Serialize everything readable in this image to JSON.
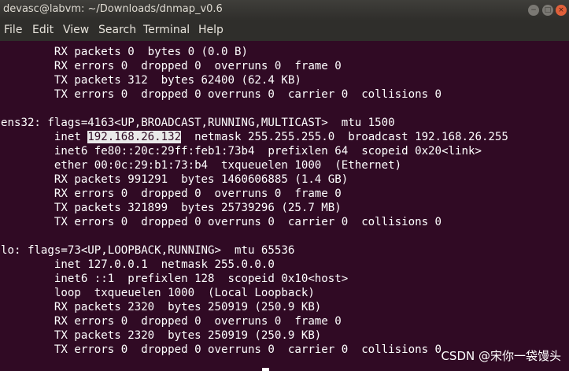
{
  "window": {
    "title": "devasc@labvm: ~/Downloads/dnmap_v0.6",
    "buttons": {
      "minimize": "−",
      "maximize": "□",
      "close": "×"
    }
  },
  "menu": [
    "File",
    "Edit",
    "View",
    "Search",
    "Terminal",
    "Help"
  ],
  "terminal": {
    "lines": [
      {
        "segments": [
          {
            "text": "        RX packets 0  bytes 0 (0.0 B)"
          }
        ]
      },
      {
        "segments": [
          {
            "text": "        RX errors 0  dropped 0  overruns 0  frame 0"
          }
        ]
      },
      {
        "segments": [
          {
            "text": "        TX packets 312  bytes 62400 (62.4 KB)"
          }
        ]
      },
      {
        "segments": [
          {
            "text": "        TX errors 0  dropped 0 overruns 0  carrier 0  collisions 0"
          }
        ]
      },
      {
        "segments": [
          {
            "text": ""
          }
        ]
      },
      {
        "segments": [
          {
            "text": "ens32: flags=4163<UP,BROADCAST,RUNNING,MULTICAST>  mtu 1500"
          }
        ]
      },
      {
        "segments": [
          {
            "text": "        inet "
          },
          {
            "text": "192.168.26.132",
            "highlight": true
          },
          {
            "text": "  netmask 255.255.255.0  broadcast 192.168.26.255"
          }
        ]
      },
      {
        "segments": [
          {
            "text": "        inet6 fe80::20c:29ff:feb1:73b4  prefixlen 64  scopeid 0x20<link>"
          }
        ]
      },
      {
        "segments": [
          {
            "text": "        ether 00:0c:29:b1:73:b4  txqueuelen 1000  (Ethernet)"
          }
        ]
      },
      {
        "segments": [
          {
            "text": "        RX packets 991291  bytes 1460606885 (1.4 GB)"
          }
        ]
      },
      {
        "segments": [
          {
            "text": "        RX errors 0  dropped 0  overruns 0  frame 0"
          }
        ]
      },
      {
        "segments": [
          {
            "text": "        TX packets 321899  bytes 25739296 (25.7 MB)"
          }
        ]
      },
      {
        "segments": [
          {
            "text": "        TX errors 0  dropped 0 overruns 0  carrier 0  collisions 0"
          }
        ]
      },
      {
        "segments": [
          {
            "text": ""
          }
        ]
      },
      {
        "segments": [
          {
            "text": "lo: flags=73<UP,LOOPBACK,RUNNING>  mtu 65536"
          }
        ]
      },
      {
        "segments": [
          {
            "text": "        inet 127.0.0.1  netmask 255.0.0.0"
          }
        ]
      },
      {
        "segments": [
          {
            "text": "        inet6 ::1  prefixlen 128  scopeid 0x10<host>"
          }
        ]
      },
      {
        "segments": [
          {
            "text": "        loop  txqueuelen 1000  (Local Loopback)"
          }
        ]
      },
      {
        "segments": [
          {
            "text": "        RX packets 2320  bytes 250919 (250.9 KB)"
          }
        ]
      },
      {
        "segments": [
          {
            "text": "        RX errors 0  dropped 0  overruns 0  frame 0"
          }
        ]
      },
      {
        "segments": [
          {
            "text": "        TX packets 2320  bytes 250919 (250.9 KB)"
          }
        ]
      },
      {
        "segments": [
          {
            "text": "        TX errors 0  dropped 0 overruns 0  carrier 0  collisions 0"
          }
        ]
      }
    ]
  },
  "watermark": "CSDN @宋你一袋馒头",
  "colors": {
    "terminal_bg": "#300a24",
    "text": "#ffffff",
    "titlebar_bg": "#3a3936"
  }
}
